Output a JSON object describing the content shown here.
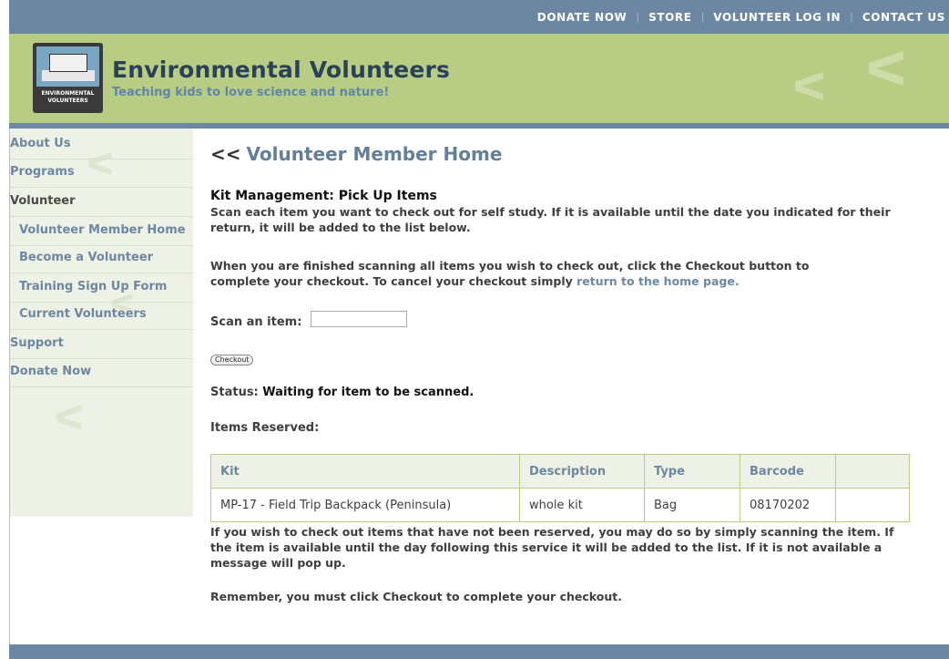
{
  "topnav": {
    "items": [
      "DONATE NOW",
      "STORE",
      "VOLUNTEER LOG IN",
      "CONTACT US"
    ],
    "separator": "|"
  },
  "header": {
    "title": "Environmental Volunteers",
    "tagline": "Teaching kids to love science and nature!",
    "logo_text": "ENVIRONMENTAL VOLUNTEERS"
  },
  "sidebar": {
    "items": [
      {
        "label": "About Us"
      },
      {
        "label": "Programs"
      },
      {
        "label": "Volunteer"
      },
      {
        "label": "Volunteer Member Home"
      },
      {
        "label": "Become a Volunteer"
      },
      {
        "label": "Training Sign Up Form"
      },
      {
        "label": "Current Volunteers"
      },
      {
        "label": "Support"
      },
      {
        "label": "Donate Now"
      }
    ]
  },
  "main": {
    "back_arrows": "<<",
    "back_link": "Volunteer Member Home",
    "section_title": "Kit Management: Pick Up Items",
    "intro": "Scan each item you want to check out for self study. If it is available until the date you indicated for their return, it will be added to the list below.",
    "instructions_prefix": "When you are finished scanning all items you wish to check out, click the Checkout button to complete your checkout. To cancel your checkout simply ",
    "instructions_link": "return to the home page.",
    "scan_label": "Scan an item:",
    "scan_value": "",
    "checkout_label": "Checkout",
    "status_label": "Status:",
    "status_value": "Waiting for item to be scanned.",
    "reserved_label": "Items Reserved:",
    "table": {
      "headers": [
        "Kit",
        "Description",
        "Type",
        "Barcode",
        ""
      ],
      "rows": [
        [
          "MP-17 - Field Trip Backpack (Peninsula)",
          "whole kit",
          "Bag",
          "08170202",
          ""
        ]
      ]
    },
    "note": "If you wish to check out items that have not been reserved, you may do so by simply scanning the item. If the item is available until the day following this service it will be added to the list. If it is not available a message will pop up.",
    "reminder": "Remember, you must click Checkout to complete your checkout."
  },
  "colors": {
    "nav_blue": "#6d87a2",
    "header_green": "#b8cd83",
    "sidebar_bg": "#eef1e5"
  }
}
